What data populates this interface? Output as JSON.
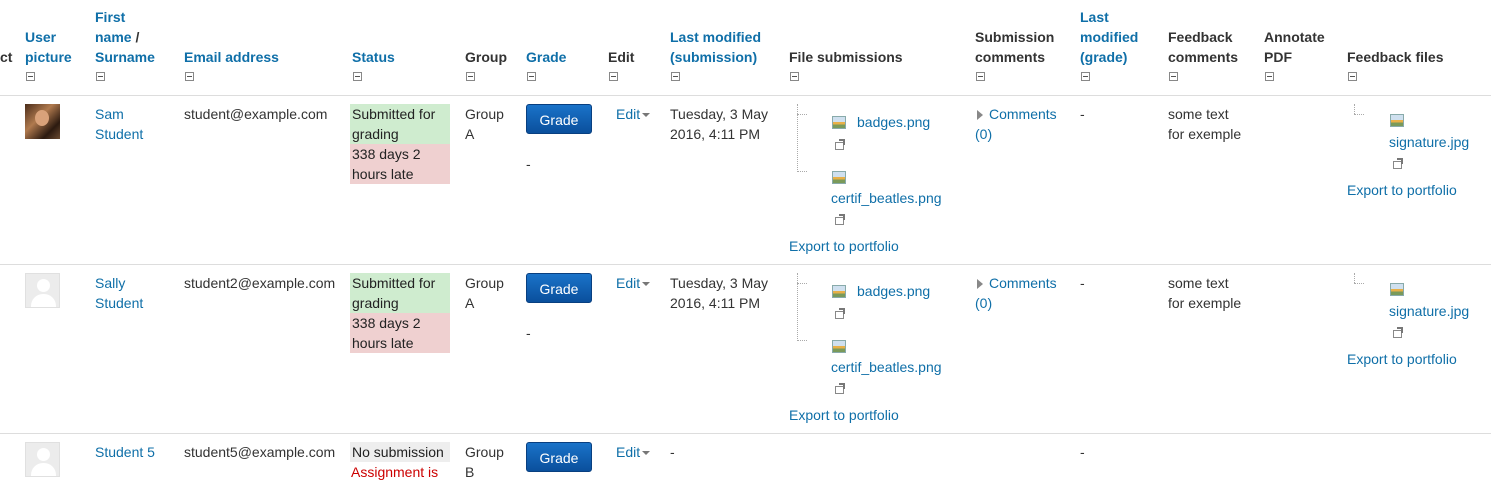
{
  "headers": {
    "select_partial": "ct",
    "user_picture_1": "User",
    "user_picture_2": "picture",
    "first_name_1": "First",
    "first_name_2": "name",
    "first_name_sep": " /",
    "surname": "Surname",
    "email": "Email address",
    "status": "Status",
    "group": "Group",
    "grade": "Grade",
    "edit": "Edit",
    "last_modified_sub_1": "Last modified",
    "last_modified_sub_2": "(submission)",
    "file_submissions": "File submissions",
    "submission_comments_1": "Submission",
    "submission_comments_2": "comments",
    "last_modified_grade_1": "Last",
    "last_modified_grade_2": "modified",
    "last_modified_grade_3": "(grade)",
    "feedback_comments_1": "Feedback",
    "feedback_comments_2": "comments",
    "annotate_pdf_1": "Annotate",
    "annotate_pdf_2": "PDF",
    "feedback_files": "Feedback files"
  },
  "rows": [
    {
      "first_name": "Sam",
      "surname": "Student",
      "email": "student@example.com",
      "status_1": "Submitted for",
      "status_2": "grading",
      "late_1": "338 days 2",
      "late_2": "hours late",
      "group_1": "Group",
      "group_2": "A",
      "grade_button": "Grade",
      "grade_value": "-",
      "edit": "Edit",
      "modified_1": "Tuesday, 3 May",
      "modified_2": "2016, 4:11 PM",
      "file_1": "badges.png",
      "file_2": "certif_beatles.png",
      "export": "Export to portfolio",
      "comments_1": "Comments",
      "comments_2": "(0)",
      "grade_modified": "-",
      "feedback_1": "some text",
      "feedback_2": "for exemple",
      "feedback_file": "signature.jpg",
      "feedback_export": "Export to portfolio"
    },
    {
      "first_name": "Sally",
      "surname": "Student",
      "email": "student2@example.com",
      "status_1": "Submitted for",
      "status_2": "grading",
      "late_1": "338 days 2",
      "late_2": "hours late",
      "group_1": "Group",
      "group_2": "A",
      "grade_button": "Grade",
      "grade_value": "-",
      "edit": "Edit",
      "modified_1": "Tuesday, 3 May",
      "modified_2": "2016, 4:11 PM",
      "file_1": "badges.png",
      "file_2": "certif_beatles.png",
      "export": "Export to portfolio",
      "comments_1": "Comments",
      "comments_2": "(0)",
      "grade_modified": "-",
      "feedback_1": "some text",
      "feedback_2": "for exemple",
      "feedback_file": "signature.jpg",
      "feedback_export": "Export to portfolio"
    },
    {
      "name": "Student 5",
      "email": "student5@example.com",
      "status_1": "No submission",
      "status_2": "Assignment is",
      "group_1": "Group",
      "group_2": "B",
      "grade_button": "Grade",
      "edit": "Edit",
      "modified": "-",
      "grade_modified": "-"
    }
  ]
}
